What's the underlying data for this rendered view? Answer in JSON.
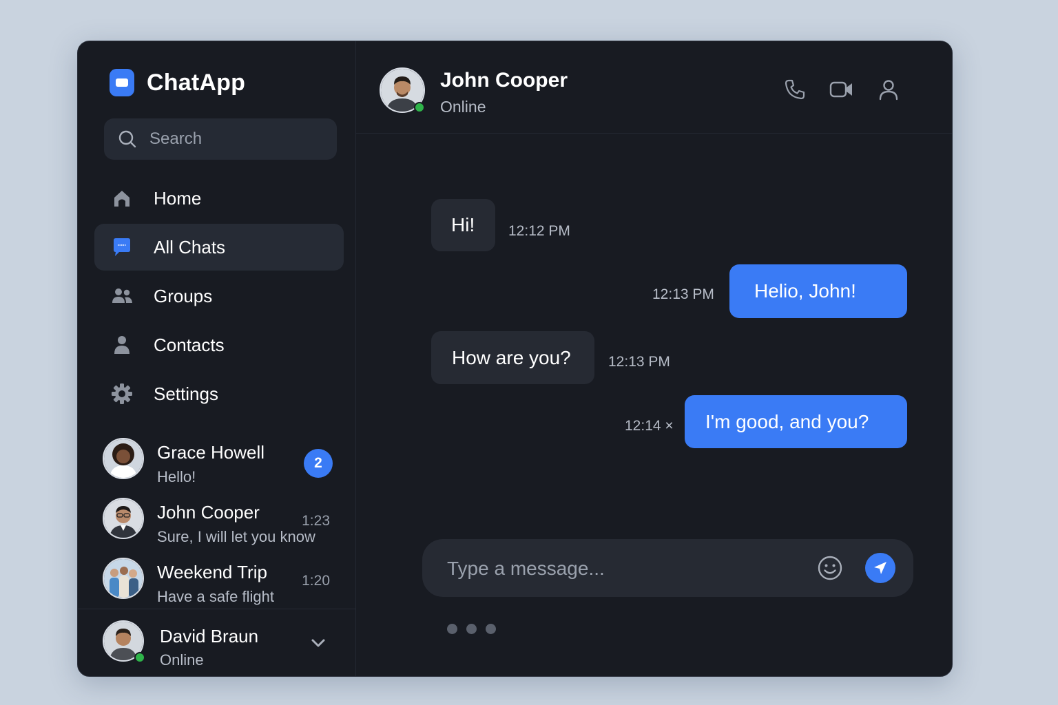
{
  "app": {
    "name": "ChatApp"
  },
  "search": {
    "placeholder": "Search"
  },
  "nav": [
    {
      "label": "Home",
      "icon": "home-icon"
    },
    {
      "label": "All Chats",
      "icon": "chat-bubble-icon",
      "active": true
    },
    {
      "label": "Groups",
      "icon": "groups-icon"
    },
    {
      "label": "Contacts",
      "icon": "contact-icon"
    },
    {
      "label": "Settings",
      "icon": "gear-icon"
    }
  ],
  "chats": [
    {
      "name": "Grace Howell",
      "preview": "Hello!",
      "time": "",
      "unread": "2"
    },
    {
      "name": "John Cooper",
      "preview": "Sure, I will let you know",
      "time": "1:23"
    },
    {
      "name": "Weekend Trip",
      "preview": "Have a safe flight",
      "time": "1:20"
    }
  ],
  "profile": {
    "name": "David Braun",
    "status": "Online"
  },
  "conversation": {
    "contact_name": "John Cooper",
    "contact_status": "Online",
    "messages": [
      {
        "direction": "in",
        "text": "Hi!",
        "time": "12:12 PM"
      },
      {
        "direction": "out",
        "text": "Helio, John!",
        "time": "12:13 PM"
      },
      {
        "direction": "in",
        "text": "How are you?",
        "time": "12:13 PM"
      },
      {
        "direction": "out",
        "text": "I'm good, and you?",
        "time": "12:14 ×"
      }
    ]
  },
  "composer": {
    "placeholder": "Type a message..."
  },
  "colors": {
    "accent": "#3a7bf5",
    "window_bg": "#181b22",
    "bubble_in": "#262a33",
    "online": "#2fb44a"
  }
}
